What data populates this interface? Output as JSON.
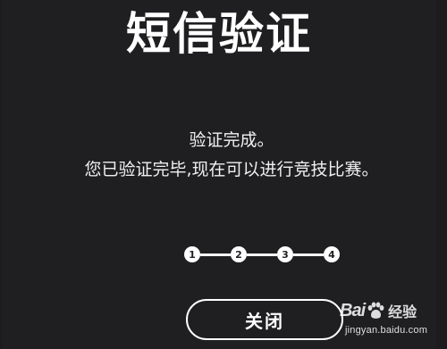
{
  "dialog": {
    "title": "短信验证",
    "message_line1": "验证完成。",
    "message_line2": "您已验证完毕,现在可以进行竞技比赛。",
    "close_label": "关闭"
  },
  "steps": [
    "1",
    "2",
    "3",
    "4"
  ],
  "watermark": {
    "brand_left": "Bai",
    "brand_right": "经验",
    "url": "jingyan.baidu.com"
  },
  "colors": {
    "background": "#1f1f21",
    "text": "#ffffff"
  }
}
